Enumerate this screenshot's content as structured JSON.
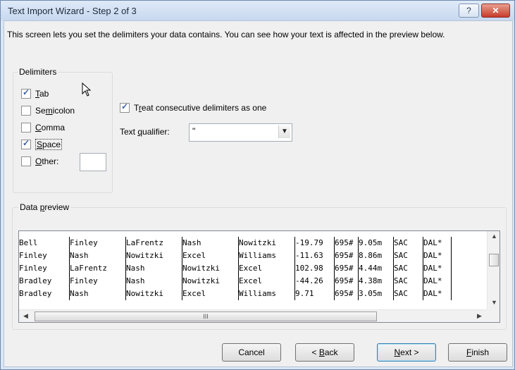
{
  "window": {
    "title": "Text Import Wizard - Step 2 of 3",
    "help_label": "?",
    "close_label": "✕"
  },
  "description": "This screen lets you set the delimiters your data contains.  You can see how your text is affected in the preview below.",
  "delimiters": {
    "legend": "Delimiters",
    "tab": {
      "label": "Tab",
      "checked": true
    },
    "semicolon": {
      "label": "Semicolon",
      "checked": false
    },
    "comma": {
      "label": "Comma",
      "checked": false
    },
    "space": {
      "label": "Space",
      "checked": true
    },
    "other": {
      "label": "Other:",
      "checked": false,
      "value": ""
    }
  },
  "treat_consecutive": {
    "label": "Treat consecutive delimiters as one",
    "checked": true
  },
  "text_qualifier": {
    "label": "Text qualifier:",
    "value": "\""
  },
  "data_preview": {
    "legend": "Data preview",
    "rows": [
      [
        "Bell",
        "Finley",
        "LaFrentz",
        "Nash",
        "Nowitzki",
        "-19.79",
        "695#",
        "9.05m",
        "SAC",
        "DAL*"
      ],
      [
        "Finley",
        "Nash",
        "Nowitzki",
        "Excel",
        "Williams",
        "-11.63",
        "695#",
        "8.86m",
        "SAC",
        "DAL*"
      ],
      [
        "Finley",
        "LaFrentz",
        "Nash",
        "Nowitzki",
        "Excel",
        "102.98",
        "695#",
        "4.44m",
        "SAC",
        "DAL*"
      ],
      [
        "Bradley",
        "Finley",
        "Nash",
        "Nowitzki",
        "Excel",
        "-44.26",
        "695#",
        "4.38m",
        "SAC",
        "DAL*"
      ],
      [
        "Bradley",
        "Nash",
        "Nowitzki",
        "Excel",
        "Williams",
        "9.71",
        "695#",
        "3.05m",
        "SAC",
        "DAL*"
      ]
    ]
  },
  "buttons": {
    "cancel": "Cancel",
    "back": "< Back",
    "next": "Next >",
    "finish": "Finish"
  },
  "colors": {
    "accent": "#3c7fb1",
    "titlebar": "#c7d8ef"
  }
}
